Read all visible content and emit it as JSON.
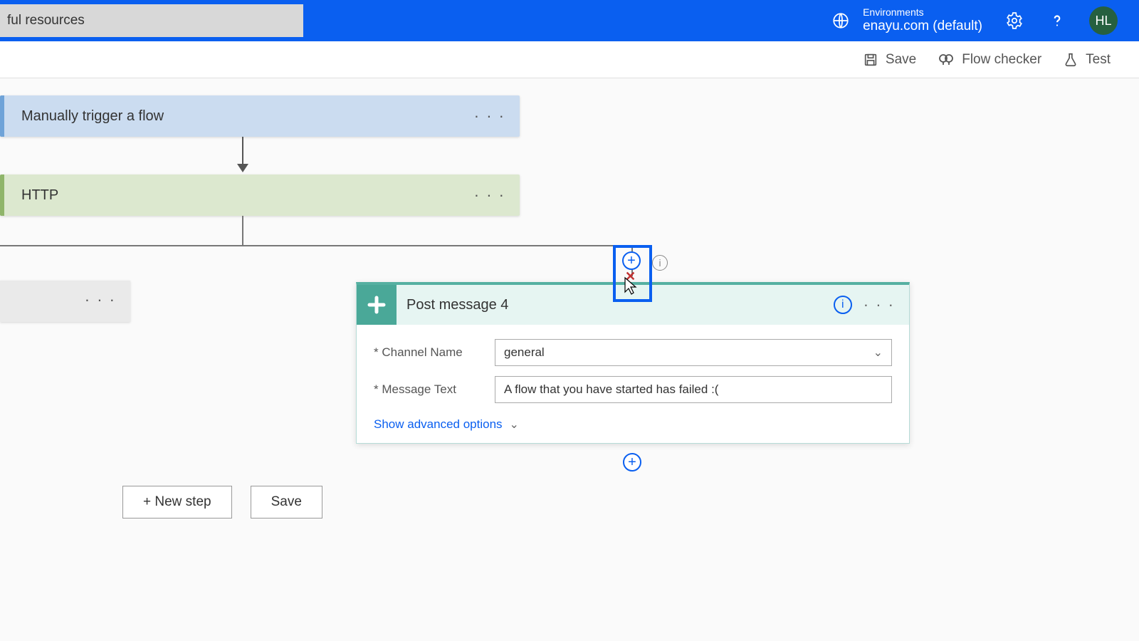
{
  "header": {
    "search_value": "ful resources",
    "environments_label": "Environments",
    "environment_name": "enayu.com (default)",
    "avatar_initials": "HL"
  },
  "commandbar": {
    "save": "Save",
    "flow_checker": "Flow checker",
    "test": "Test"
  },
  "steps": {
    "trigger_title": "Manually trigger a flow",
    "http_title": "HTTP"
  },
  "action_card": {
    "title": "Post message 4",
    "channel_label": "* Channel Name",
    "channel_value": "general",
    "message_label": "* Message Text",
    "message_value": "A flow that you have started has failed :(",
    "advanced_link": "Show advanced options"
  },
  "bottom": {
    "new_step": "+ New step",
    "save": "Save"
  }
}
